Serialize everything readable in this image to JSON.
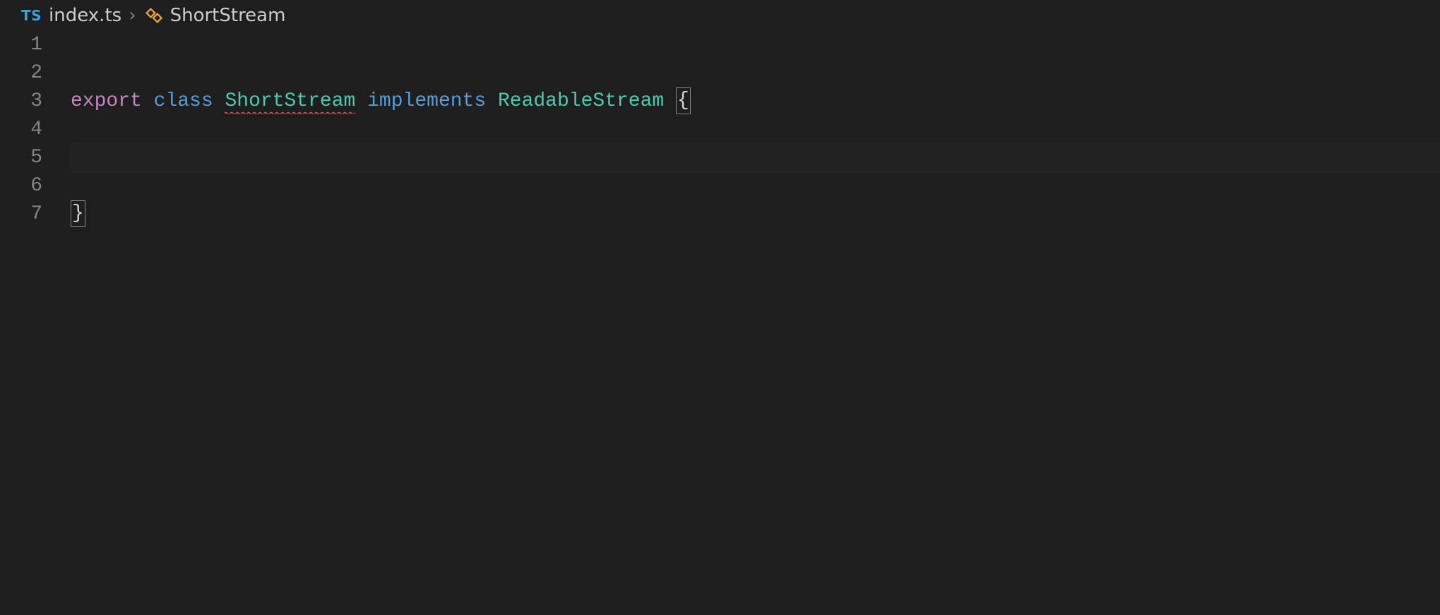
{
  "breadcrumb": {
    "file_badge": "TS",
    "filename": "index.ts",
    "separator": "›",
    "symbol": "ShortStream"
  },
  "editor": {
    "line_numbers": [
      "1",
      "2",
      "3",
      "4",
      "5",
      "6",
      "7"
    ],
    "active_line_index": 4,
    "tokens": {
      "export_kw": "export",
      "class_kw": "class",
      "class_name": "ShortStream",
      "implements_kw": "implements",
      "interface_name": "ReadableStream",
      "open_brace": "{",
      "close_brace": "}"
    },
    "diagnostics": {
      "class_name_error": true
    }
  }
}
